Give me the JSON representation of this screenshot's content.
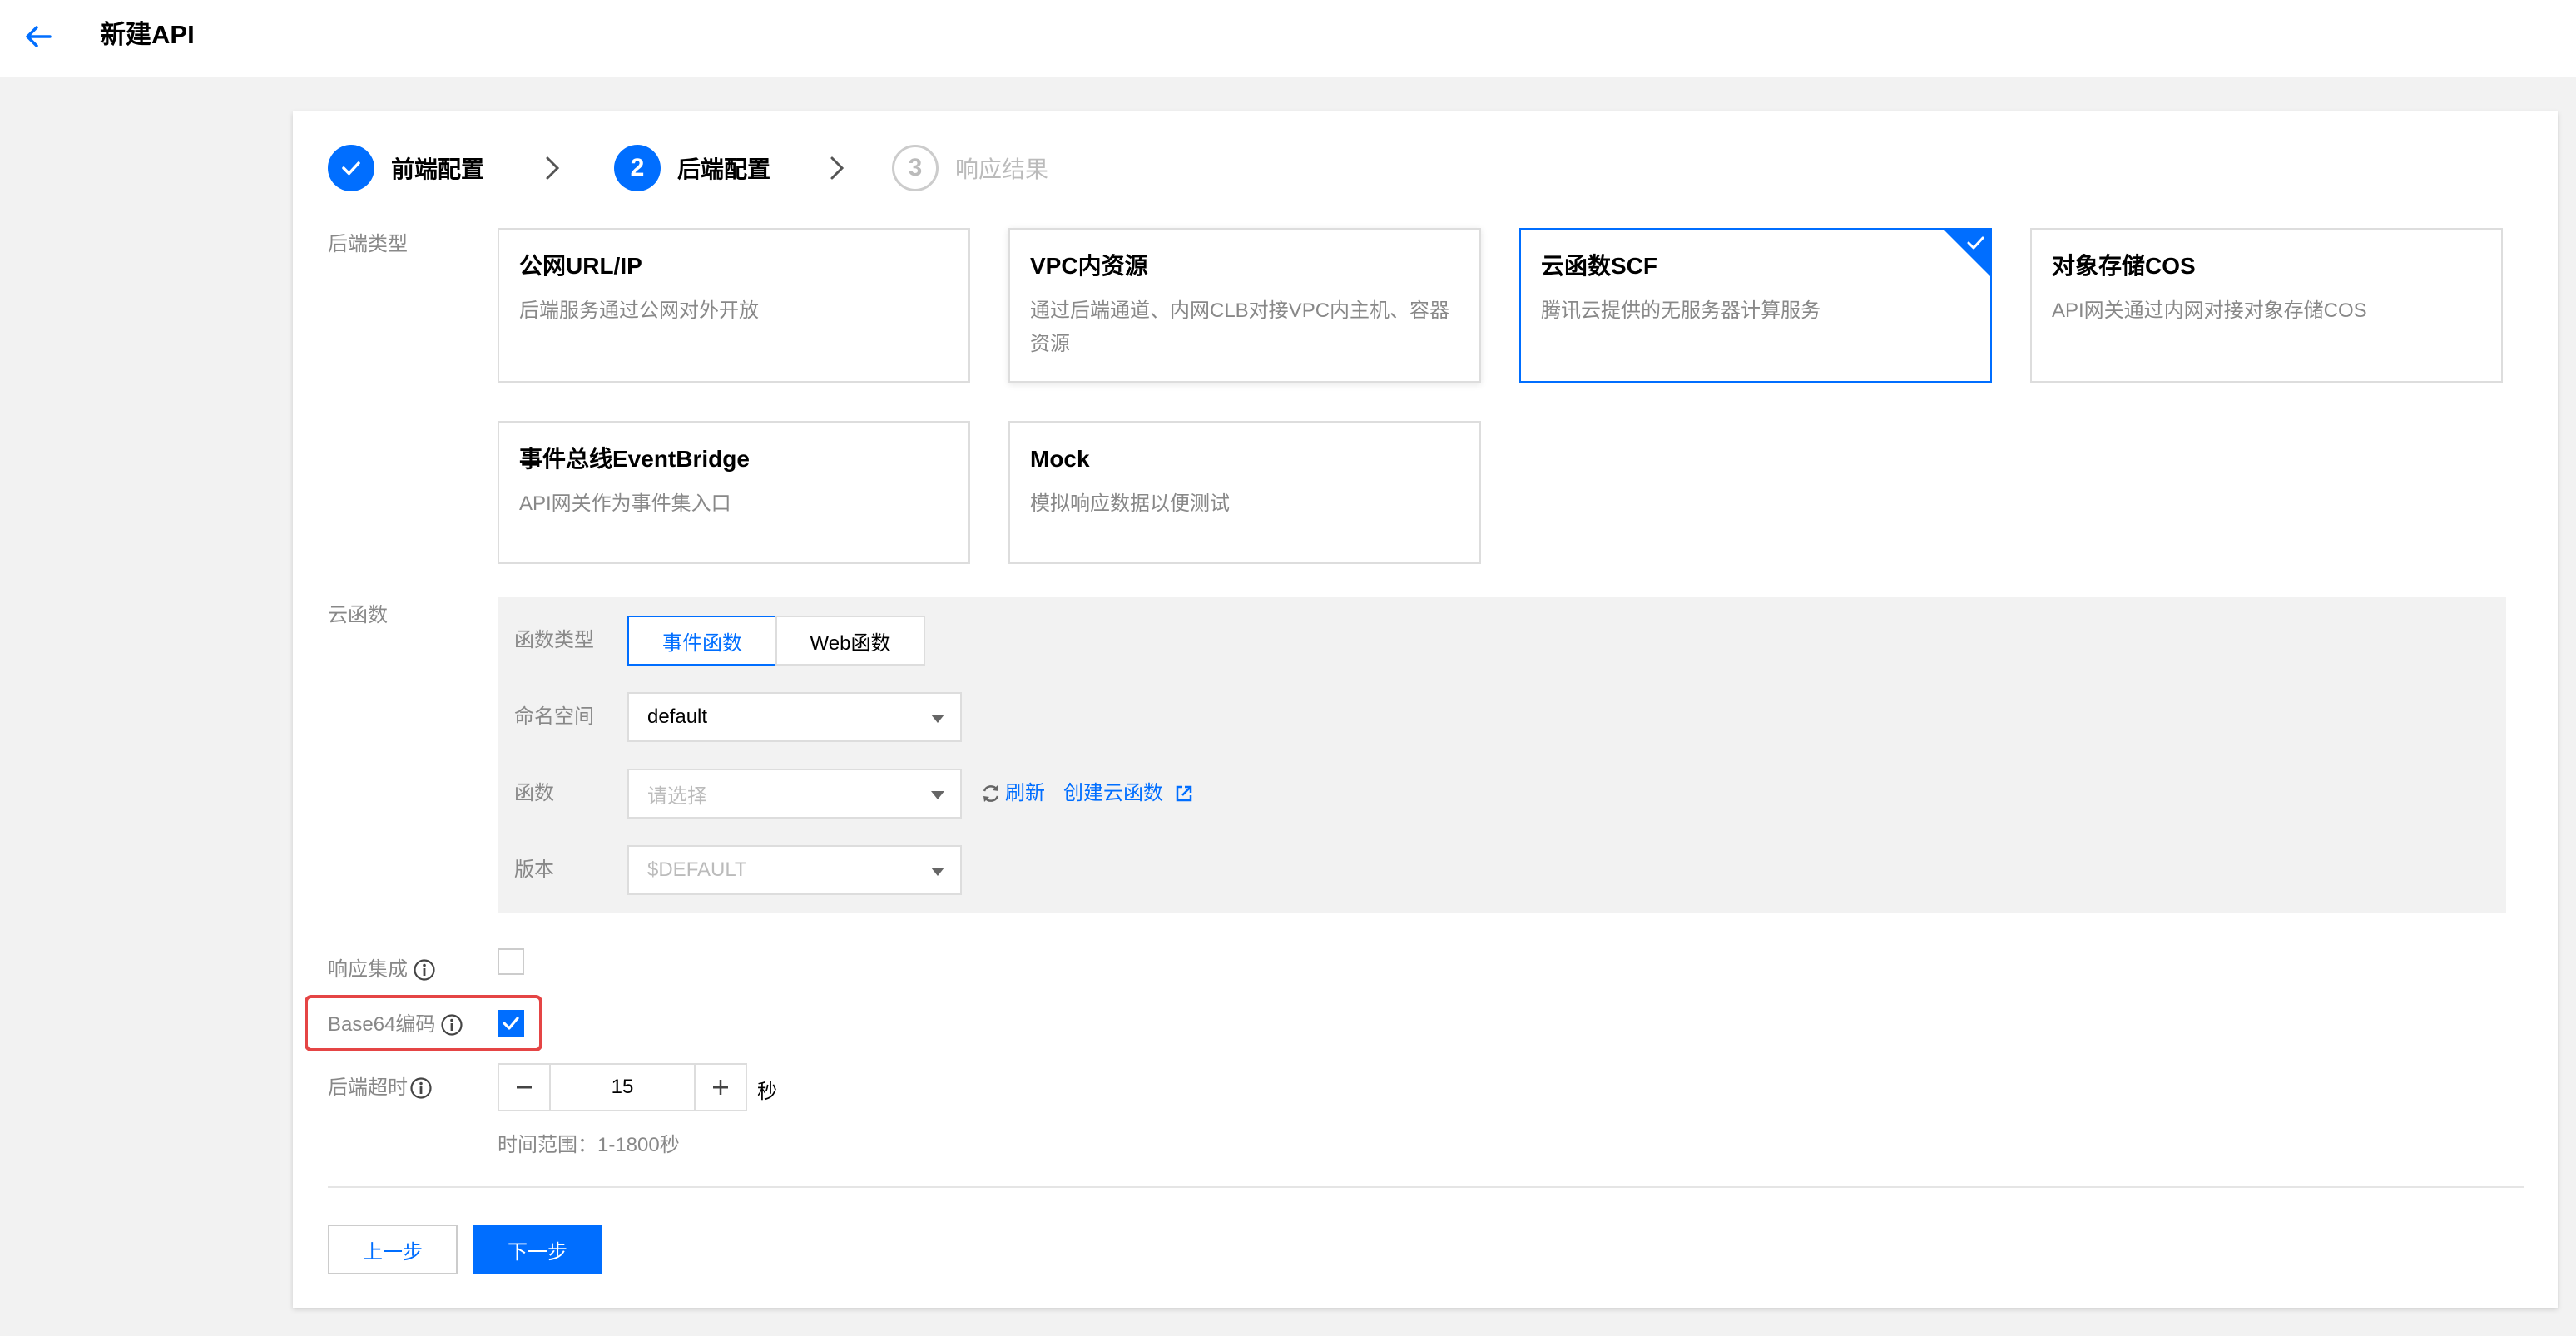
{
  "header": {
    "title": "新建API"
  },
  "steps": [
    {
      "number": "",
      "label": "前端配置",
      "state": "done"
    },
    {
      "number": "2",
      "label": "后端配置",
      "state": "active"
    },
    {
      "number": "3",
      "label": "响应结果",
      "state": "todo"
    }
  ],
  "backend_type": {
    "label": "后端类型",
    "options": [
      {
        "title": "公网URL/IP",
        "desc": "后端服务通过公网对外开放"
      },
      {
        "title": "VPC内资源",
        "desc": "通过后端通道、内网CLB对接VPC内主机、容器资源"
      },
      {
        "title": "云函数SCF",
        "desc": "腾讯云提供的无服务器计算服务"
      },
      {
        "title": "对象存储COS",
        "desc": "API网关通过内网对接对象存储COS"
      },
      {
        "title": "事件总线EventBridge",
        "desc": "API网关作为事件集入口"
      },
      {
        "title": "Mock",
        "desc": "模拟响应数据以便测试"
      }
    ],
    "selected": "云函数SCF"
  },
  "scf": {
    "label": "云函数",
    "function_type": {
      "label": "函数类型",
      "options": [
        "事件函数",
        "Web函数"
      ],
      "selected": "事件函数"
    },
    "namespace": {
      "label": "命名空间",
      "value": "default"
    },
    "function": {
      "label": "函数",
      "placeholder": "请选择",
      "refresh_label": "刷新",
      "create_label": "创建云函数"
    },
    "version": {
      "label": "版本",
      "value": "$DEFAULT"
    }
  },
  "response_integration": {
    "label": "响应集成",
    "checked": false
  },
  "base64": {
    "label": "Base64编码",
    "checked": true
  },
  "timeout": {
    "label": "后端超时",
    "value": "15",
    "unit": "秒",
    "hint": "时间范围：1-1800秒"
  },
  "actions": {
    "prev_label": "上一步",
    "next_label": "下一步"
  },
  "colors": {
    "accent": "#006eff",
    "highlight": "#e54545"
  }
}
